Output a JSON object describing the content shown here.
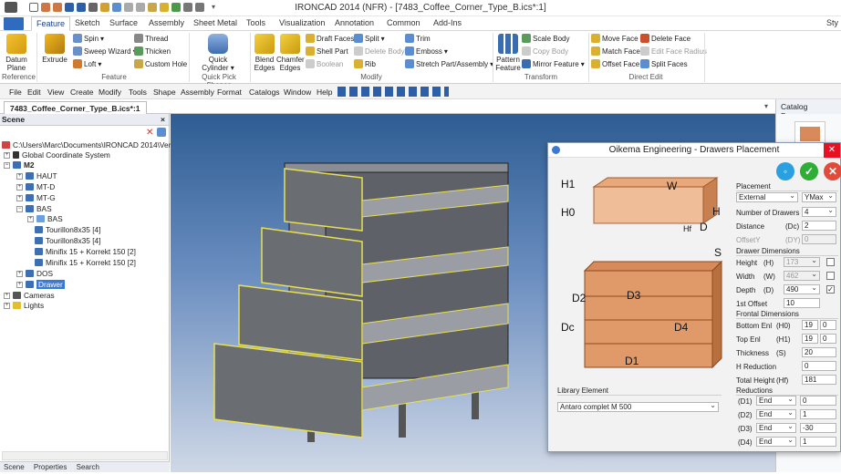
{
  "window": {
    "title": "IRONCAD 2014 (NFR) - [7483_Coffee_Corner_Type_B.ics*:1]"
  },
  "ribbon_tabs": [
    "Feature",
    "Sketch",
    "Surface",
    "Assembly",
    "Sheet Metal",
    "Tools",
    "Visualization",
    "Annotation",
    "Common",
    "Add-Ins"
  ],
  "ribbon": {
    "datum_plane": "Datum Plane",
    "extrude": "Extrude",
    "spin": "Spin",
    "sweep_wizard": "Sweep Wizard",
    "loft": "Loft",
    "thread": "Thread",
    "thicken": "Thicken",
    "custom_hole": "Custom Hole",
    "quick_cylinder": "Quick Cylinder",
    "blend_edges": "Blend Edges",
    "chamfer_edges": "Chamfer Edges",
    "draft_faces": "Draft Faces",
    "shell_part": "Shell Part",
    "boolean": "Boolean",
    "split": "Split",
    "delete_body": "Delete Body",
    "rib": "Rib",
    "trim": "Trim",
    "emboss": "Emboss",
    "stretch": "Stretch Part/Assembly",
    "pattern_feature": "Pattern Feature",
    "scale_body": "Scale Body",
    "copy_body": "Copy Body",
    "mirror_feature": "Mirror Feature",
    "move_face": "Move Face",
    "match_face": "Match Face",
    "offset_face": "Offset Face",
    "delete_face": "Delete Face",
    "edit_face_radius": "Edit Face Radius",
    "split_faces": "Split Faces",
    "groups": [
      "Reference",
      "Feature",
      "Quick Pick Shapes",
      "Modify",
      "Transform",
      "Direct Edit"
    ],
    "right_cut": "Sty"
  },
  "menus": [
    "File",
    "Edit",
    "View",
    "Create",
    "Modify",
    "Tools",
    "Shape",
    "Assembly",
    "Format",
    "Catalogs",
    "Window",
    "Help"
  ],
  "doc_tab": "7483_Coffee_Corner_Type_B.ics*:1",
  "catalog_browser": "Catalog Browser",
  "scene": {
    "title": "Scene",
    "items": [
      "C:\\Users\\Marc\\Documents\\IRONCAD 2014\\Verbi",
      "Global Coordinate System",
      "M2",
      "HAUT",
      "MT-D",
      "MT-G",
      "BAS",
      "BAS",
      "Tourillon8x35 [4]",
      "Tourillon8x35 [4]",
      "Minifix 15 + Korrekt 150 [2]",
      "Minifix 15 + Korrekt 150 [2]",
      "DOS",
      "Drawer",
      "Cameras",
      "Lights"
    ],
    "bottom_tabs": [
      "Scene",
      "Properties",
      "Search"
    ]
  },
  "dialog": {
    "title": "Oikema Engineering - Drawers Placement",
    "diagram_labels": {
      "h1": "H1",
      "h0": "H0",
      "w": "W",
      "h": "H",
      "d": "D",
      "hf": "Hf",
      "s": "S",
      "d2": "D2",
      "d3": "D3",
      "dc": "Dc",
      "d4": "D4",
      "d1": "D1"
    },
    "library_label": "Library Element",
    "library_value": "Antaro complet M 500",
    "placement_label": "Placement",
    "placement_value": "External",
    "placement_axis": "YMax",
    "num_drawers_label": "Number of Drawers",
    "num_drawers": "4",
    "distance_label": "Distance",
    "distance_code": "(Dc)",
    "distance": "2",
    "offsety_label": "OffsetY",
    "offsety_code": "(DY)",
    "offsety": "0",
    "drawer_dims_label": "Drawer Dimensions",
    "height_label": "Height",
    "height_code": "(H)",
    "height": "173",
    "width_label": "Width",
    "width_code": "(W)",
    "width": "462",
    "depth_label": "Depth",
    "depth_code": "(D)",
    "depth": "490",
    "first_offset_label": "1st Offset",
    "first_offset": "10",
    "frontal_label": "Frontal Dimensions",
    "bottom_enl_label": "Bottom Enl",
    "bottom_enl_code": "(H0)",
    "bottom_enl": "19",
    "bottom_enl_b": "0",
    "top_enl_label": "Top Enl",
    "top_enl_code": "(H1)",
    "top_enl": "19",
    "top_enl_b": "0",
    "thickness_label": "Thickness",
    "thickness_code": "(S)",
    "thickness": "20",
    "h_reduction_label": "H Reduction",
    "h_reduction": "0",
    "total_height_label": "Total Height",
    "total_height_code": "(Hf)",
    "total_height": "181",
    "reductions_label": "Reductions",
    "reductions": [
      {
        "code": "(D1)",
        "mode": "End",
        "value": "0"
      },
      {
        "code": "(D2)",
        "mode": "End",
        "value": "1"
      },
      {
        "code": "(D3)",
        "mode": "End",
        "value": "-30"
      },
      {
        "code": "(D4)",
        "mode": "End",
        "value": "1"
      }
    ],
    "checks": {
      "check_mark": "✓"
    }
  },
  "colors": {
    "accent": "#3a7ad4",
    "ribbon_tab_active": "#1a3e8c",
    "close": "#e81123",
    "ok": "#2eae34",
    "info": "#2aa0e0",
    "cancel": "#e24a3a",
    "wood": "#d98a5a"
  }
}
